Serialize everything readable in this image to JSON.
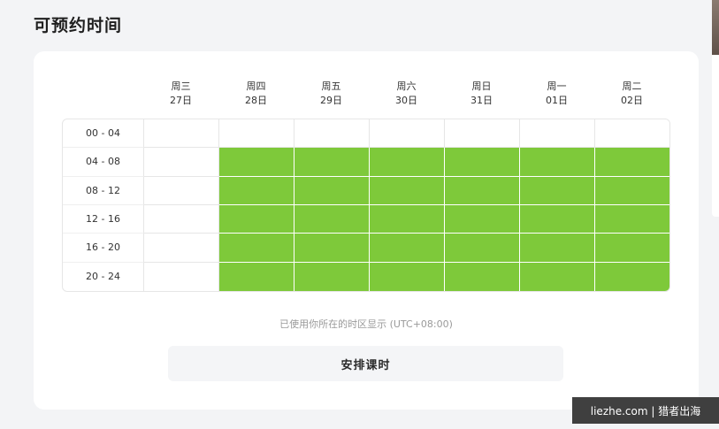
{
  "section": {
    "title": "可预约时间"
  },
  "days": [
    {
      "weekday": "周三",
      "date": "27日"
    },
    {
      "weekday": "周四",
      "date": "28日"
    },
    {
      "weekday": "周五",
      "date": "29日"
    },
    {
      "weekday": "周六",
      "date": "30日"
    },
    {
      "weekday": "周日",
      "date": "31日"
    },
    {
      "weekday": "周一",
      "date": "01日"
    },
    {
      "weekday": "周二",
      "date": "02日"
    }
  ],
  "time_slots": [
    {
      "label": "00 - 04",
      "available": [
        false,
        false,
        false,
        false,
        false,
        false,
        false
      ]
    },
    {
      "label": "04 - 08",
      "available": [
        false,
        true,
        true,
        true,
        true,
        true,
        true
      ]
    },
    {
      "label": "08 - 12",
      "available": [
        false,
        true,
        true,
        true,
        true,
        true,
        true
      ]
    },
    {
      "label": "12 - 16",
      "available": [
        false,
        true,
        true,
        true,
        true,
        true,
        true
      ]
    },
    {
      "label": "16 - 20",
      "available": [
        false,
        true,
        true,
        true,
        true,
        true,
        true
      ]
    },
    {
      "label": "20 - 24",
      "available": [
        false,
        true,
        true,
        true,
        true,
        true,
        true
      ]
    }
  ],
  "timezone_note": "已使用你所在的时区显示 (UTC+08:00)",
  "schedule_button": {
    "label": "安排课时"
  },
  "watermark": {
    "text": "liezhe.com | 猎者出海"
  },
  "colors": {
    "available": "#7ec93a",
    "unavailable": "#ffffff",
    "background": "#f3f4f6"
  }
}
